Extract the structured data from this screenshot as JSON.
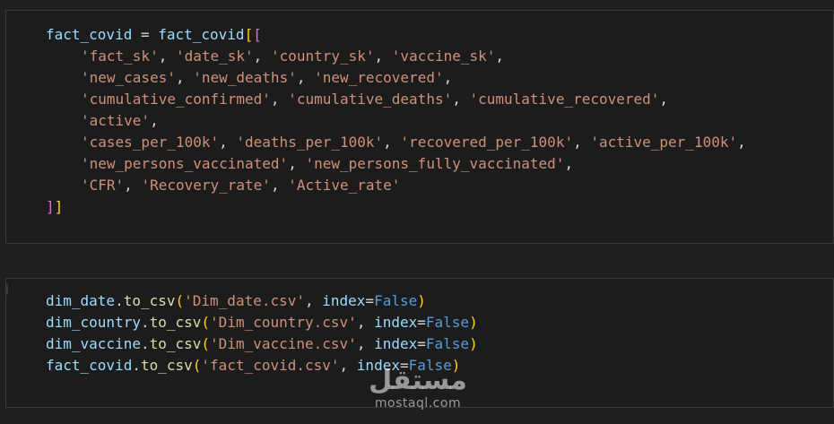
{
  "cell1": {
    "line1": {
      "v1": "fact_covid",
      "eq": " = ",
      "v2": "fact_covid",
      "b1": "[",
      "b2": "["
    },
    "line2": {
      "s1": "'fact_sk'",
      "s2": "'date_sk'",
      "s3": "'country_sk'",
      "s4": "'vaccine_sk'"
    },
    "line3": {
      "s1": "'new_cases'",
      "s2": "'new_deaths'",
      "s3": "'new_recovered'"
    },
    "line4": {
      "s1": "'cumulative_confirmed'",
      "s2": "'cumulative_deaths'",
      "s3": "'cumulative_recovered'"
    },
    "line5": {
      "s1": "'active'"
    },
    "line6": {
      "s1": "'cases_per_100k'",
      "s2": "'deaths_per_100k'",
      "s3": "'recovered_per_100k'",
      "s4": "'active_per_100k'"
    },
    "line7": {
      "s1": "'new_persons_vaccinated'",
      "s2": "'new_persons_fully_vaccinated'"
    },
    "line8": {
      "s1": "'CFR'",
      "s2": "'Recovery_rate'",
      "s3": "'Active_rate'"
    },
    "line9": {
      "b1": "]",
      "b2": "]"
    }
  },
  "cell2": {
    "lines": [
      {
        "obj": "dim_date",
        "method": "to_csv",
        "file": "'Dim_date.csv'",
        "param": "index",
        "val": "False"
      },
      {
        "obj": "dim_country",
        "method": "to_csv",
        "file": "'Dim_country.csv'",
        "param": "index",
        "val": "False"
      },
      {
        "obj": "dim_vaccine",
        "method": "to_csv",
        "file": "'Dim_vaccine.csv'",
        "param": "index",
        "val": "False"
      },
      {
        "obj": "fact_covid",
        "method": "to_csv",
        "file": "'fact_covid.csv'",
        "param": "index",
        "val": "False"
      }
    ]
  },
  "watermark": {
    "arabic": "مستقل",
    "latin": "mostaql.com"
  },
  "colors": {
    "background": "#1f1f1f",
    "variable": "#9cdcfe",
    "function": "#dcdcaa",
    "string": "#ce9178",
    "keyword": "#569cd6",
    "bracket_outer": "#ffd700",
    "bracket_inner": "#da70d6"
  }
}
